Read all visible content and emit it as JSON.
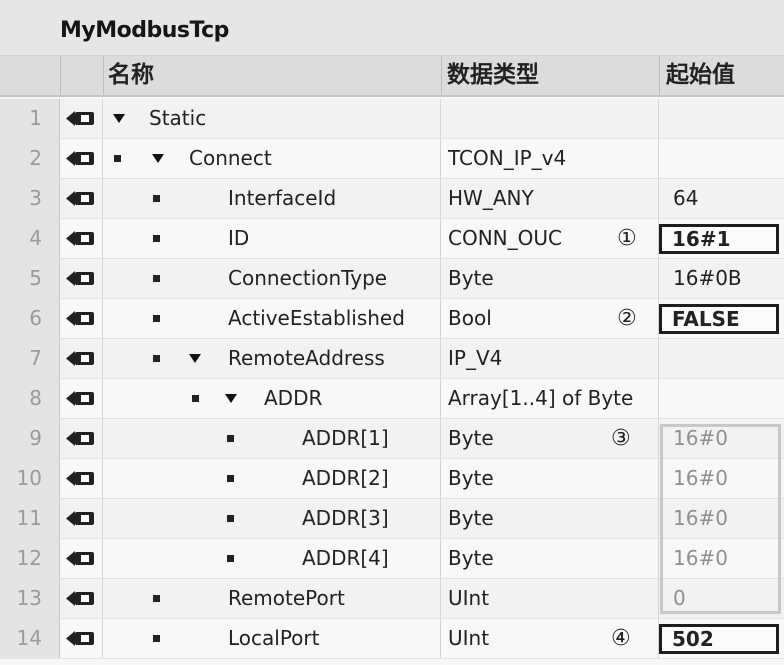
{
  "title": "MyModbusTcp",
  "headers": {
    "name": "名称",
    "datatype": "数据类型",
    "start": "起始值"
  },
  "rows": [
    {
      "num": "1",
      "name": "Static",
      "type": "",
      "start": "",
      "callout": ""
    },
    {
      "num": "2",
      "name": "Connect",
      "type": "TCON_IP_v4",
      "start": "",
      "callout": ""
    },
    {
      "num": "3",
      "name": "InterfaceId",
      "type": "HW_ANY",
      "start": "64",
      "callout": ""
    },
    {
      "num": "4",
      "name": "ID",
      "type": "CONN_OUC",
      "start": "16#1",
      "callout": "①"
    },
    {
      "num": "5",
      "name": "ConnectionType",
      "type": "Byte",
      "start": "16#0B",
      "callout": ""
    },
    {
      "num": "6",
      "name": "ActiveEstablished",
      "type": "Bool",
      "start": "FALSE",
      "callout": "②"
    },
    {
      "num": "7",
      "name": "RemoteAddress",
      "type": "IP_V4",
      "start": "",
      "callout": ""
    },
    {
      "num": "8",
      "name": "ADDR",
      "type": "Array[1..4] of Byte",
      "start": "",
      "callout": ""
    },
    {
      "num": "9",
      "name": "ADDR[1]",
      "type": "Byte",
      "start": "16#0",
      "callout": "③"
    },
    {
      "num": "10",
      "name": "ADDR[2]",
      "type": "Byte",
      "start": "16#0",
      "callout": ""
    },
    {
      "num": "11",
      "name": "ADDR[3]",
      "type": "Byte",
      "start": "16#0",
      "callout": ""
    },
    {
      "num": "12",
      "name": "ADDR[4]",
      "type": "Byte",
      "start": "16#0",
      "callout": ""
    },
    {
      "num": "13",
      "name": "RemotePort",
      "type": "UInt",
      "start": "0",
      "callout": ""
    },
    {
      "num": "14",
      "name": "LocalPort",
      "type": "UInt",
      "start": "502",
      "callout": "④"
    }
  ]
}
